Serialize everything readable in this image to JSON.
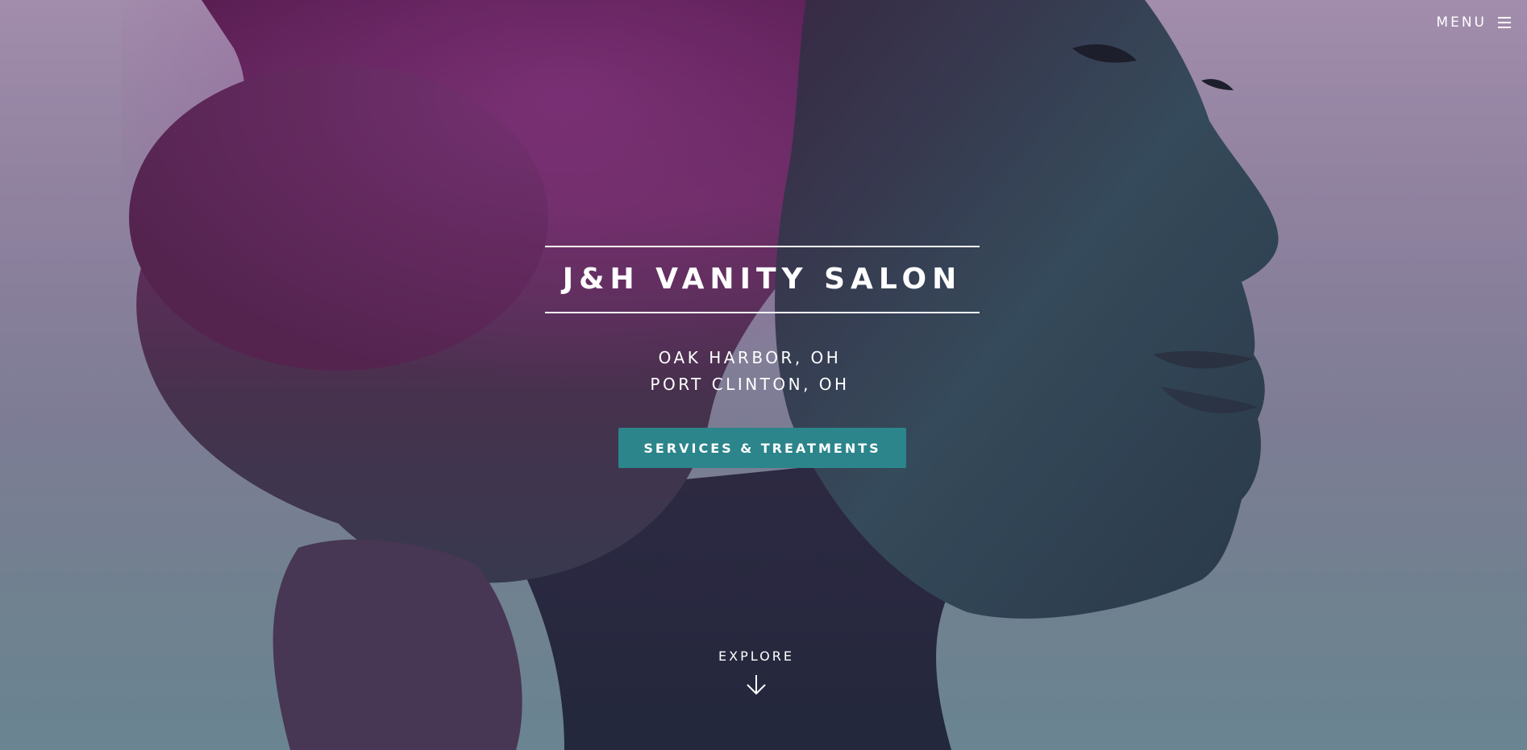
{
  "header": {
    "menu_label": "MENU",
    "menu_icon": "hamburger-icon"
  },
  "hero": {
    "title": "J&H VANITY SALON",
    "locations": [
      "OAK HARBOR, OH",
      "PORT CLINTON, OH"
    ],
    "cta_label": "SERVICES & TREATMENTS",
    "explore_label": "EXPLORE",
    "explore_icon": "arrow-down-icon",
    "background_image": "woman-profile-portrait"
  },
  "colors": {
    "accent": "#2b858b",
    "text": "#ffffff",
    "bg_top": "#b39cbc",
    "bg_bottom": "#73929f",
    "hair": "#6b2a62",
    "skin": "#2f4b5a"
  }
}
